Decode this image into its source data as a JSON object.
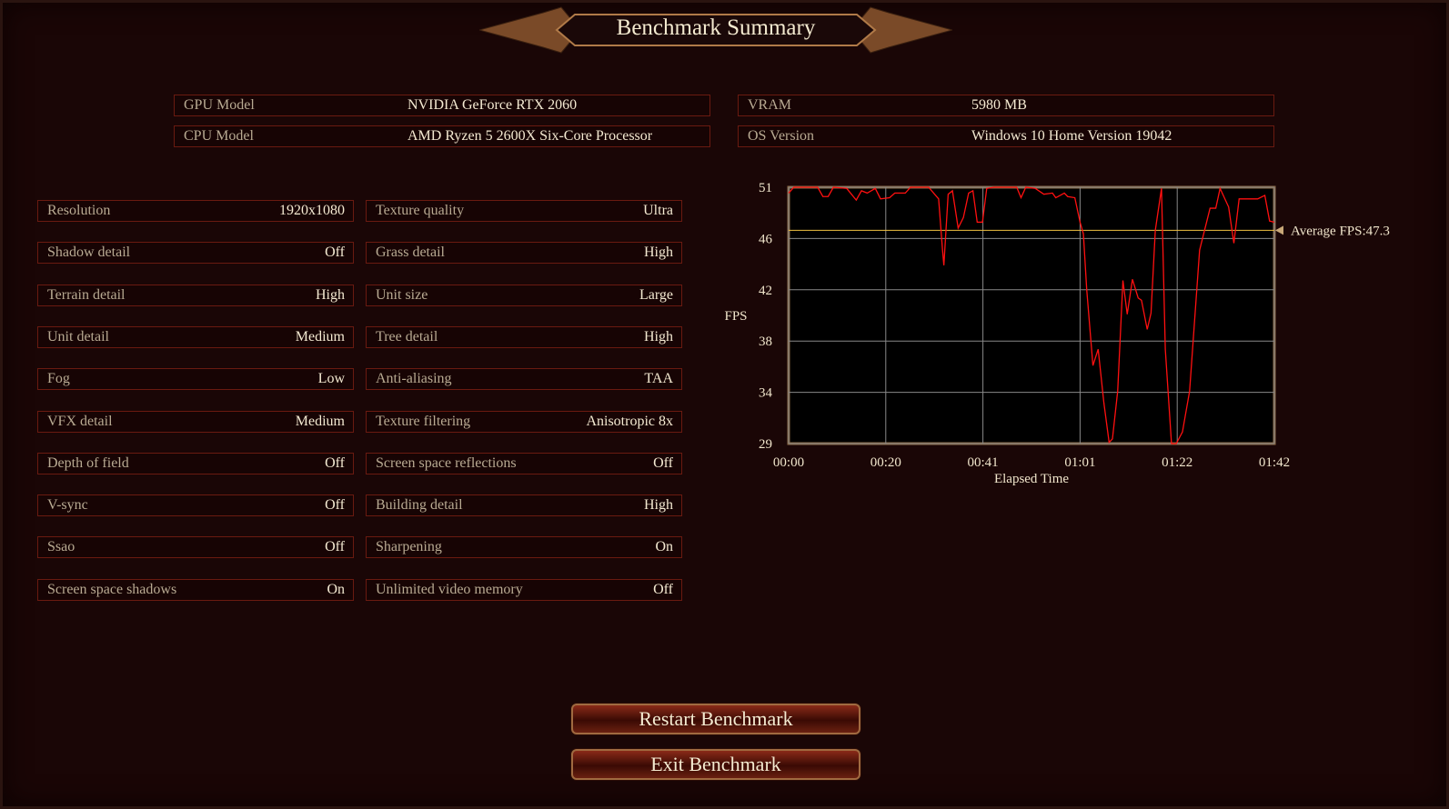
{
  "header": {
    "title": "Benchmark Summary"
  },
  "system": [
    {
      "label": "GPU Model",
      "value": "NVIDIA GeForce RTX 2060"
    },
    {
      "label": "VRAM",
      "value": "5980 MB"
    },
    {
      "label": "CPU Model",
      "value": "AMD Ryzen 5 2600X Six-Core Processor"
    },
    {
      "label": "OS Version",
      "value": "Windows 10 Home Version 19042"
    }
  ],
  "settings_left": [
    {
      "label": "Resolution",
      "value": "1920x1080"
    },
    {
      "label": "Shadow detail",
      "value": "Off"
    },
    {
      "label": "Terrain detail",
      "value": "High"
    },
    {
      "label": "Unit detail",
      "value": "Medium"
    },
    {
      "label": "Fog",
      "value": "Low"
    },
    {
      "label": "VFX detail",
      "value": "Medium"
    },
    {
      "label": "Depth of field",
      "value": "Off"
    },
    {
      "label": "V-sync",
      "value": "Off"
    },
    {
      "label": "Ssao",
      "value": "Off"
    },
    {
      "label": "Screen space shadows",
      "value": "On"
    }
  ],
  "settings_right": [
    {
      "label": "Texture quality",
      "value": "Ultra"
    },
    {
      "label": "Grass detail",
      "value": "High"
    },
    {
      "label": "Unit size",
      "value": "Large"
    },
    {
      "label": "Tree detail",
      "value": "High"
    },
    {
      "label": "Anti-aliasing",
      "value": "TAA"
    },
    {
      "label": "Texture filtering",
      "value": "Anisotropic 8x"
    },
    {
      "label": "Screen space reflections",
      "value": "Off"
    },
    {
      "label": "Building detail",
      "value": "High"
    },
    {
      "label": "Sharpening",
      "value": "On"
    },
    {
      "label": "Unlimited video memory",
      "value": "Off"
    }
  ],
  "chart_data": {
    "type": "line",
    "xlabel": "Elapsed Time",
    "ylabel": "FPS",
    "ylim": [
      29,
      51
    ],
    "xlim": [
      0,
      102
    ],
    "yticks": [
      {
        "v": 51,
        "label": "51"
      },
      {
        "v": 46.6,
        "label": "46"
      },
      {
        "v": 42.2,
        "label": "42"
      },
      {
        "v": 37.8,
        "label": "38"
      },
      {
        "v": 33.4,
        "label": "34"
      },
      {
        "v": 29,
        "label": "29"
      }
    ],
    "xticks": [
      {
        "v": 0,
        "label": "00:00"
      },
      {
        "v": 20.4,
        "label": "00:20"
      },
      {
        "v": 40.8,
        "label": "00:41"
      },
      {
        "v": 61.2,
        "label": "01:01"
      },
      {
        "v": 81.6,
        "label": "01:22"
      },
      {
        "v": 102,
        "label": "01:42"
      }
    ],
    "grid": true,
    "average": {
      "value": 47.3,
      "label": "Average FPS:47.3"
    },
    "line_color": "#ff1010",
    "series": [
      {
        "name": "FPS",
        "points": [
          [
            0,
            50.5
          ],
          [
            1.1,
            51
          ],
          [
            6.1,
            51
          ],
          [
            7.2,
            50.2
          ],
          [
            8.3,
            50.2
          ],
          [
            9.4,
            51
          ],
          [
            12.2,
            50.9
          ],
          [
            14.2,
            49.9
          ],
          [
            15.3,
            50.7
          ],
          [
            16.5,
            50.5
          ],
          [
            18.2,
            50.9
          ],
          [
            19.3,
            50
          ],
          [
            21.2,
            50.1
          ],
          [
            22.3,
            50.5
          ],
          [
            24.5,
            50.5
          ],
          [
            25.6,
            51
          ],
          [
            29.4,
            51
          ],
          [
            31.5,
            50
          ],
          [
            32.3,
            45.7
          ],
          [
            32.6,
            44.3
          ],
          [
            33.5,
            50.4
          ],
          [
            34.4,
            50.7
          ],
          [
            35.6,
            47.5
          ],
          [
            36.7,
            48.4
          ],
          [
            37.8,
            50.5
          ],
          [
            38.7,
            50.7
          ],
          [
            39.6,
            48
          ],
          [
            40.7,
            48
          ],
          [
            41.6,
            50.9
          ],
          [
            43.2,
            51
          ],
          [
            47.9,
            51
          ],
          [
            48.8,
            50.1
          ],
          [
            49.8,
            51
          ],
          [
            51.8,
            50.9
          ],
          [
            53.6,
            50.4
          ],
          [
            55.4,
            50.5
          ],
          [
            56.1,
            50.1
          ],
          [
            57.9,
            50.5
          ],
          [
            58.6,
            50.2
          ],
          [
            60.1,
            50.1
          ],
          [
            61.2,
            48
          ],
          [
            61.9,
            47
          ],
          [
            62.6,
            42.2
          ],
          [
            63.9,
            35.7
          ],
          [
            65,
            37.1
          ],
          [
            66.2,
            32.5
          ],
          [
            67.3,
            29.1
          ],
          [
            68,
            29.4
          ],
          [
            69.1,
            33.5
          ],
          [
            70.2,
            43
          ],
          [
            71.1,
            40.1
          ],
          [
            72.2,
            43.1
          ],
          [
            73.4,
            41.5
          ],
          [
            74.1,
            41.3
          ],
          [
            75.3,
            38.8
          ],
          [
            76.1,
            40.2
          ],
          [
            77,
            47.3
          ],
          [
            78.3,
            50.9
          ],
          [
            79.1,
            37.1
          ],
          [
            80.4,
            29
          ],
          [
            81.4,
            29
          ],
          [
            82.7,
            30
          ],
          [
            84.2,
            33.5
          ],
          [
            86.3,
            45.6
          ],
          [
            88.5,
            49.2
          ],
          [
            89.7,
            49.2
          ],
          [
            90.6,
            50.9
          ],
          [
            92.4,
            49.3
          ],
          [
            93.5,
            46.2
          ],
          [
            94.6,
            50
          ],
          [
            98.5,
            50
          ],
          [
            100,
            50.3
          ],
          [
            101,
            48.1
          ],
          [
            102,
            48
          ]
        ]
      }
    ]
  },
  "buttons": {
    "restart": "Restart Benchmark",
    "exit": "Exit Benchmark"
  }
}
